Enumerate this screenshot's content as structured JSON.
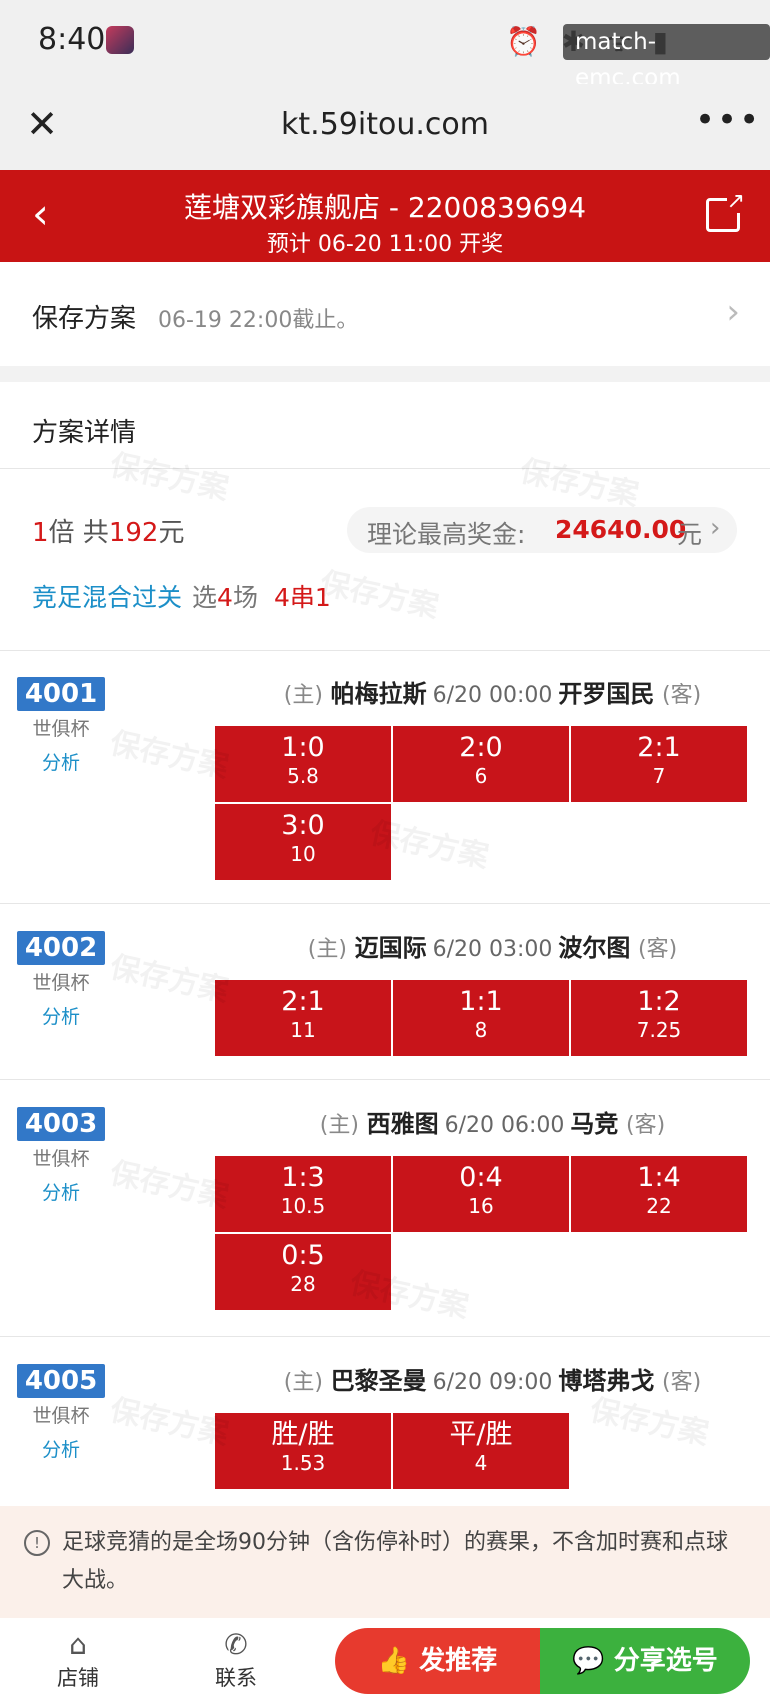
{
  "status_bar": {
    "time": "8:40",
    "system_icons": "⏰ ✱ ᯤ ▮",
    "watermark": "match-emc.com"
  },
  "browser": {
    "url": "kt.59itou.com"
  },
  "header": {
    "title": "莲塘双彩旗舰店 - 2200839694",
    "subtitle": "预计 06-20 11:00 开奖"
  },
  "save_plan": {
    "title": "保存方案",
    "deadline": "06-19 22:00截止。"
  },
  "detail": {
    "title": "方案详情",
    "multiplier": "1",
    "multiplier_unit": "倍 共",
    "amount": "192",
    "amount_unit": "元",
    "prize_label": "理论最高奖金:",
    "prize_value": "24640.00",
    "prize_unit": "元",
    "play_type": "竞足混合过关",
    "pick_prefix": "选",
    "pick_count": "4",
    "pick_suffix": "场",
    "combo": "4串1",
    "watermark_text": "保存方案"
  },
  "matches": [
    {
      "no": "4001",
      "league": "世俱杯",
      "analysis": "分析",
      "home_tag": "(主)",
      "home": "帕梅拉斯",
      "time": "6/20 00:00",
      "away": "开罗国民",
      "away_tag": "(客)",
      "picks": [
        {
          "score": "1:0",
          "odds": "5.8"
        },
        {
          "score": "2:0",
          "odds": "6"
        },
        {
          "score": "2:1",
          "odds": "7"
        },
        {
          "score": "3:0",
          "odds": "10"
        }
      ]
    },
    {
      "no": "4002",
      "league": "世俱杯",
      "analysis": "分析",
      "home_tag": "(主)",
      "home": "迈国际",
      "time": "6/20 03:00",
      "away": "波尔图",
      "away_tag": "(客)",
      "picks": [
        {
          "score": "2:1",
          "odds": "11"
        },
        {
          "score": "1:1",
          "odds": "8"
        },
        {
          "score": "1:2",
          "odds": "7.25"
        }
      ]
    },
    {
      "no": "4003",
      "league": "世俱杯",
      "analysis": "分析",
      "home_tag": "(主)",
      "home": "西雅图",
      "time": "6/20 06:00",
      "away": "马竞",
      "away_tag": "(客)",
      "picks": [
        {
          "score": "1:3",
          "odds": "10.5"
        },
        {
          "score": "0:4",
          "odds": "16"
        },
        {
          "score": "1:4",
          "odds": "22"
        },
        {
          "score": "0:5",
          "odds": "28"
        }
      ]
    },
    {
      "no": "4005",
      "league": "世俱杯",
      "analysis": "分析",
      "home_tag": "(主)",
      "home": "巴黎圣曼",
      "time": "6/20 09:00",
      "away": "博塔弗戈",
      "away_tag": "(客)",
      "picks": [
        {
          "score": "胜/胜",
          "odds": "1.53"
        },
        {
          "score": "平/胜",
          "odds": "4"
        }
      ]
    }
  ],
  "notice": {
    "text": "足球竞猜的是全场90分钟（含伤停补时）的赛果，不含加时赛和点球大战。"
  },
  "bottom_nav": {
    "store": "店铺",
    "contact": "联系",
    "recommend": "发推荐",
    "share_pick": "分享选号"
  },
  "colors": {
    "brand_red": "#c81414",
    "pick_red": "#c8141a",
    "match_blue": "#3278c8",
    "link_blue": "#1c8fc8",
    "share_green": "#3cb13e",
    "recommend_red": "#e73a2e"
  }
}
